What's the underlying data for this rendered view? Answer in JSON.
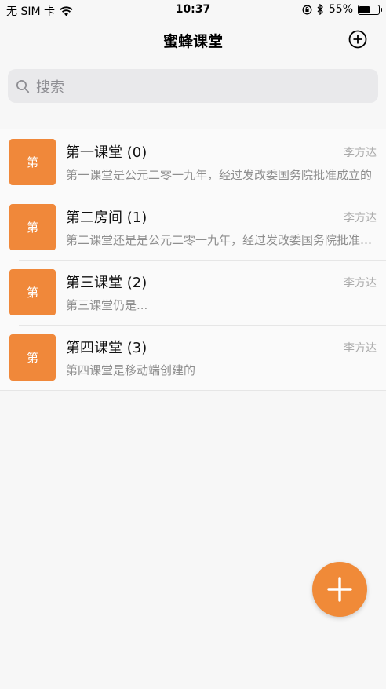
{
  "status_bar": {
    "carrier": "无 SIM 卡",
    "time": "10:37",
    "battery_percent": "55%",
    "battery_level": 0.55,
    "icons": [
      "wifi-icon",
      "orientation-lock-icon",
      "bluetooth-icon",
      "battery-icon"
    ]
  },
  "nav": {
    "title": "蜜蜂课堂",
    "add_icon": "plus-circle-icon"
  },
  "search": {
    "placeholder": "搜索",
    "icon": "search-icon"
  },
  "list": {
    "items": [
      {
        "avatar_text": "第",
        "title": "第一课堂 (0)",
        "author": "李方达",
        "description": "第一课堂是公元二零一九年，经过发改委国务院批准成立的"
      },
      {
        "avatar_text": "第",
        "title": "第二房间 (1)",
        "author": "李方达",
        "description": "第二课堂还是是公元二零一九年，经过发改委国务院批准成立的"
      },
      {
        "avatar_text": "第",
        "title": "第三课堂 (2)",
        "author": "李方达",
        "description": "第三课堂仍是..."
      },
      {
        "avatar_text": "第",
        "title": "第四课堂 (3)",
        "author": "李方达",
        "description": "第四课堂是移动端创建的"
      }
    ]
  },
  "fab": {
    "icon": "plus-icon"
  },
  "colors": {
    "accent": "#f0883a",
    "background": "#f7f7f7",
    "search_bg": "#e9e9eb"
  }
}
